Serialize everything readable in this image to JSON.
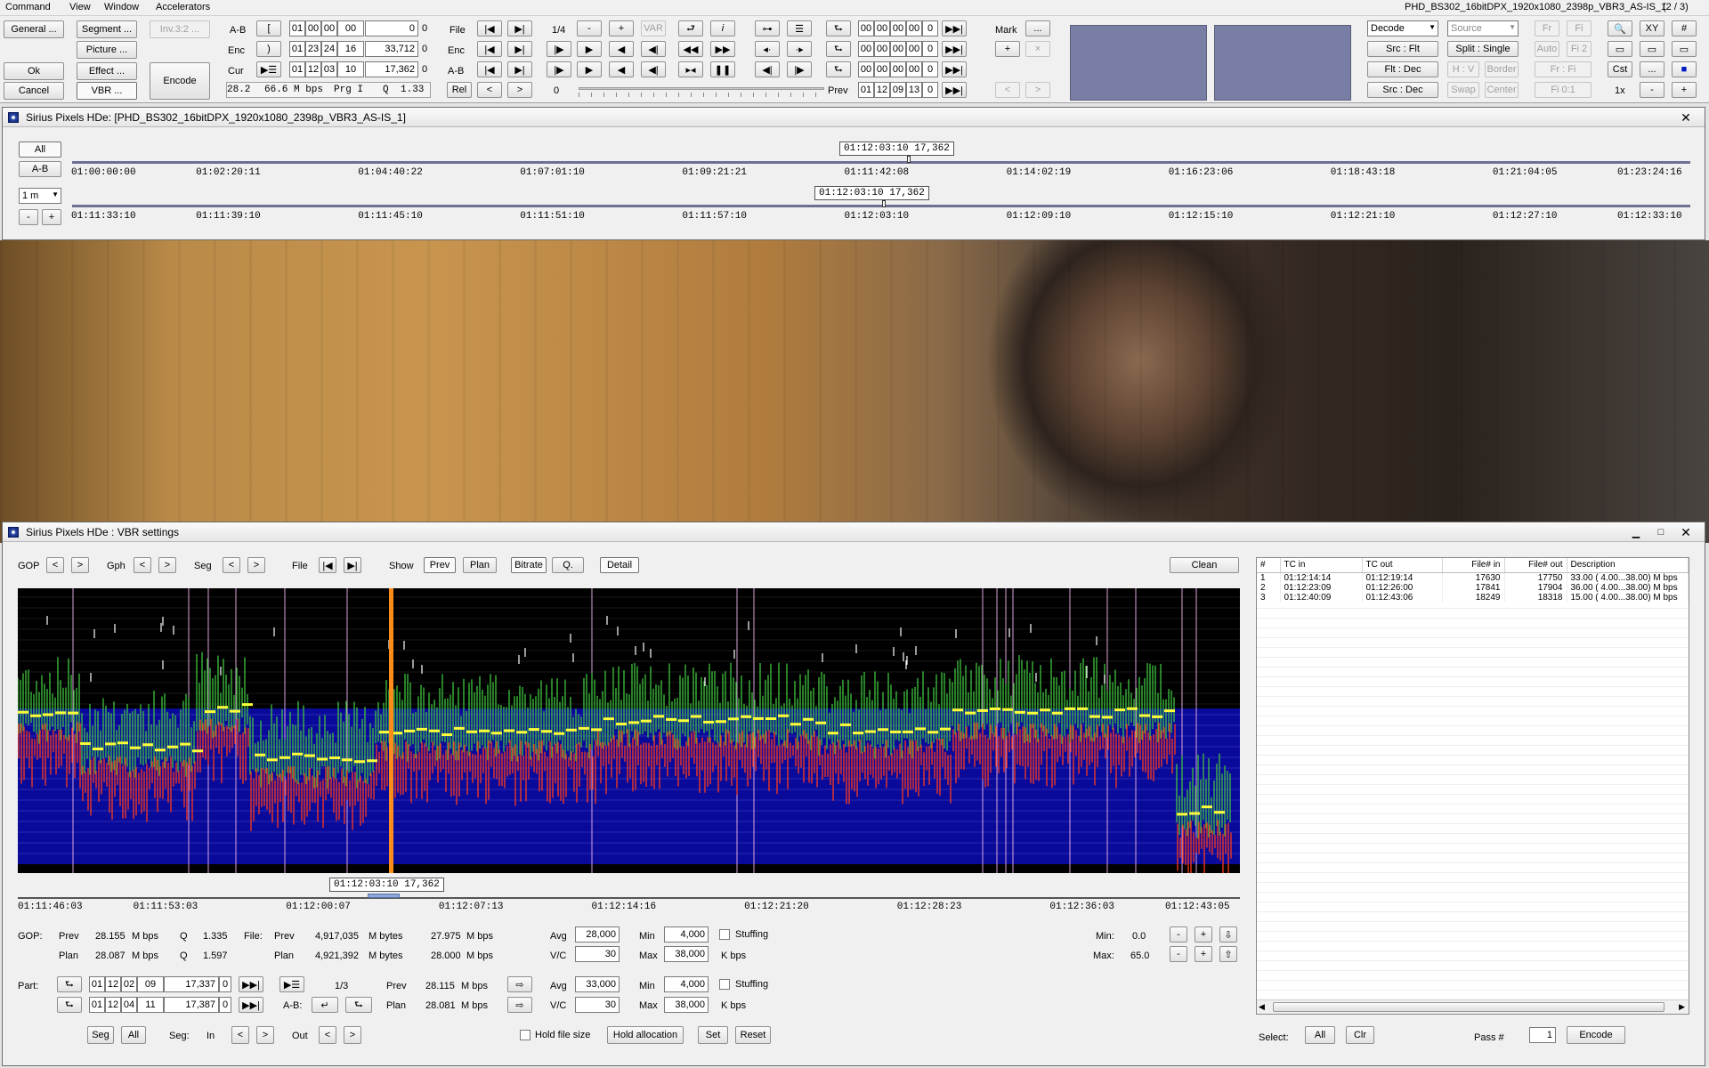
{
  "menu": {
    "items": [
      "Command",
      "View",
      "Window",
      "Accelerators"
    ],
    "right_title": "PHD_BS302_16bitDPX_1920x1080_2398p_VBR3_AS-IS_1",
    "right_count": "(2 / 3)"
  },
  "toolbar": {
    "general": "General ...",
    "segment": "Segment ...",
    "inv": "Inv.3:2 ...",
    "picture": "Picture ...",
    "ok": "Ok",
    "effect": "Effect ...",
    "cancel": "Cancel",
    "vbr": "VBR ...",
    "encode": "Encode",
    "ab": "A-B",
    "enc": "Enc",
    "cur": "Cur",
    "bracket_open": "[",
    "bracket_close": ")",
    "ab_tc": [
      "01",
      "00",
      "00",
      "00"
    ],
    "ab_val": "0",
    "ab_flag": "0",
    "enc_tc": [
      "01",
      "23",
      "24",
      "16"
    ],
    "enc_val": "33,712",
    "enc_flag": "0",
    "cur_tc": [
      "01",
      "12",
      "03",
      "10"
    ],
    "cur_val": "17,362",
    "cur_flag": "0",
    "status": [
      "28.2",
      "66.6 M bps",
      "Prg I",
      "Q",
      "1.33"
    ],
    "file": "File",
    "enc2": "Enc",
    "ab2": "A-B",
    "rel": "Rel",
    "quarter": "1/4",
    "minus": "-",
    "plus": "+",
    "var": "VAR",
    "zero": "0",
    "mark": "Mark",
    "prev": "Prev",
    "dots": "...",
    "out1": [
      "00",
      "00",
      "00",
      "00",
      "0"
    ],
    "out2": [
      "00",
      "00",
      "00",
      "00",
      "0"
    ],
    "out3": [
      "00",
      "00",
      "00",
      "00",
      "0"
    ],
    "prev_tc": [
      "01",
      "12",
      "09",
      "13",
      "0"
    ],
    "decode": "Decode",
    "source": "Source",
    "fr": "Fr",
    "fi": "Fi",
    "xy": "XY",
    "hash": "#",
    "src_flt": "Src : Flt",
    "split_single": "Split : Single",
    "auto": "Auto",
    "fi2": "Fi 2",
    "flt_dec": "Flt : Dec",
    "hv": "H : V",
    "border": "Border",
    "fr_fi": "Fr : Fi",
    "cst": "Cst",
    "src_dec": "Src : Dec",
    "swap": "Swap",
    "center": "Center",
    "fi01": "Fi 0:1",
    "x1": "1x",
    "minus2": "-",
    "plus2": "+"
  },
  "timeline_window": {
    "title": "Sirius Pixels HDe: [PHD_BS302_16bitDPX_1920x1080_2398p_VBR3_AS-IS_1]",
    "all": "All",
    "ab": "A-B",
    "zoom": "1 m",
    "minus": "-",
    "plus": "+",
    "cursor_top": "01:12:03:10 17,362",
    "cursor_bottom": "01:12:03:10 17,362",
    "top_marks": [
      "01:00:00:00",
      "01:02:20:11",
      "01:04:40:22",
      "01:07:01:10",
      "01:09:21:21",
      "01:11:42:08",
      "01:14:02:19",
      "01:16:23:06",
      "01:18:43:18",
      "01:21:04:05",
      "01:23:24:16"
    ],
    "bottom_marks": [
      "01:11:33:10",
      "01:11:39:10",
      "01:11:45:10",
      "01:11:51:10",
      "01:11:57:10",
      "01:12:03:10",
      "01:12:09:10",
      "01:12:15:10",
      "01:12:21:10",
      "01:12:27:10",
      "01:12:33:10"
    ]
  },
  "vbr_window": {
    "title": "Sirius Pixels HDe : VBR settings",
    "gop": "GOP",
    "gph": "Gph",
    "seg": "Seg",
    "file": "File",
    "show": "Show",
    "prev": "Prev",
    "plan": "Plan",
    "bitrate": "Bitrate",
    "q": "Q.",
    "detail": "Detail",
    "clean": "Clean",
    "cursor": "01:12:03:10 17,362",
    "axis_marks": [
      "01:11:46:03",
      "01:11:53:03",
      "01:12:00:07",
      "01:12:07:13",
      "01:12:14:16",
      "01:12:21:20",
      "01:12:28:23",
      "01:12:36:03",
      "01:12:43:05"
    ],
    "stats": {
      "gop_label": "GOP:",
      "prev": "Prev",
      "plan": "Plan",
      "gop_prev_rate": "28.155",
      "gop_plan_rate": "28.087",
      "mbps": "M bps",
      "q": "Q",
      "gop_prev_q": "1.335",
      "gop_plan_q": "1.597",
      "file_label": "File:",
      "file_prev_bytes": "4,917,035",
      "file_plan_bytes": "4,921,392",
      "mbytes": "M bytes",
      "file_prev_rate": "27.975",
      "file_plan_rate": "28.000",
      "avg": "Avg",
      "vc": "V/C",
      "min": "Min",
      "max": "Max",
      "kbps": "K bps",
      "avg1": "28,000",
      "vc1": "30",
      "min1": "4,000",
      "max1": "38,000",
      "avg2": "33,000",
      "vc2": "30",
      "min2": "4,000",
      "max2": "38,000",
      "stuffing": "Stuffing",
      "min_lbl": "Min:",
      "min_val": "0.0",
      "max_lbl": "Max:",
      "max_val": "65.0"
    },
    "part": {
      "label": "Part:",
      "tc1": [
        "01",
        "12",
        "02",
        "09"
      ],
      "val1": "17,337",
      "f1": "0",
      "tc2": [
        "01",
        "12",
        "04",
        "11"
      ],
      "val2": "17,387",
      "f2": "0",
      "frac": "1/3",
      "ab": "A-B:",
      "prev": "Prev",
      "plan": "Plan",
      "prev_rate": "28.115",
      "plan_rate": "28.081",
      "mbps": "M bps"
    },
    "bottom": {
      "seg": "Seg",
      "all": "All",
      "seg_lbl": "Seg:",
      "in": "In",
      "out": "Out",
      "hold_file": "Hold file size",
      "hold_alloc": "Hold allocation",
      "set": "Set",
      "reset": "Reset",
      "select": "Select:",
      "sel_all": "All",
      "clr": "Clr",
      "pass": "Pass #",
      "pass_val": "1",
      "encode": "Encode"
    },
    "events": {
      "headers": [
        "#",
        "TC in",
        "TC out",
        "File# in",
        "File# out",
        "Description"
      ],
      "rows": [
        [
          "1",
          "01:12:14:14",
          "01:12:19:14",
          "17630",
          "17750",
          "33.00 ( 4.00...38.00) M bps"
        ],
        [
          "2",
          "01:12:23:09",
          "01:12:26:00",
          "17841",
          "17904",
          "36.00 ( 4.00...38.00) M bps"
        ],
        [
          "3",
          "01:12:40:09",
          "01:12:43:06",
          "18249",
          "18318",
          "15.00 ( 4.00...38.00) M bps"
        ]
      ]
    }
  },
  "chart_data": {
    "type": "bar",
    "series": [
      {
        "values": []
      }
    ],
    "colors": {
      "background": "#000000",
      "band": "#0a0a9a",
      "prev": "#3fc43f",
      "plan": "#ff3a1a",
      "avg": "#ffff3a",
      "cursor": "#ff8c1a",
      "divider": "#d9a4d9"
    }
  }
}
